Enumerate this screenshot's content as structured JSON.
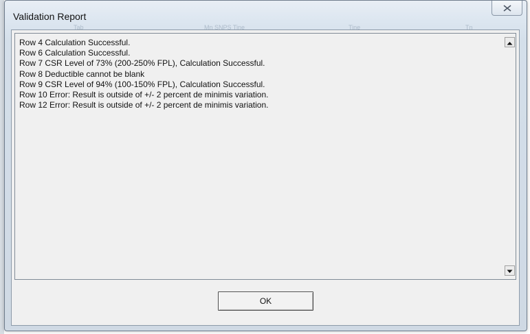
{
  "window": {
    "title": "Validation Report"
  },
  "background_ghost": [
    "Tab",
    "Mn SNPS Tine",
    "Tine",
    "Tn"
  ],
  "report": {
    "lines": [
      "Row 4 Calculation Successful.",
      "Row 6 Calculation Successful.",
      "Row 7 CSR Level of 73% (200-250% FPL), Calculation Successful.",
      "Row 8 Deductible cannot be blank",
      "Row 9 CSR Level of 94% (100-150% FPL), Calculation Successful.",
      "Row 10 Error: Result is outside of +/- 2 percent de minimis variation.",
      "Row 12 Error: Result is outside of +/- 2 percent de minimis variation."
    ]
  },
  "buttons": {
    "ok_label": "OK"
  },
  "icons": {
    "close": "close-x-icon",
    "scroll_up": "scroll-up-arrow-icon",
    "scroll_down": "scroll-down-arrow-icon"
  },
  "colors": {
    "titlebar": "#dce6f0",
    "text": "#111111",
    "content_bg": "#f0f0f0"
  }
}
